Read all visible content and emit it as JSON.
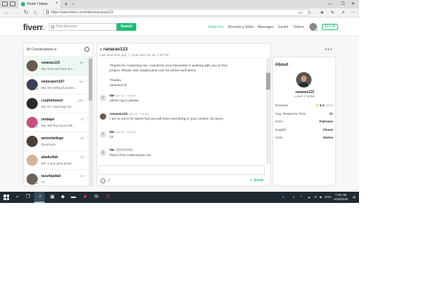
{
  "browser": {
    "tab_title": "Fiverr / Inbox",
    "url": "https://www.fiverr.com/inbox/ranarao123",
    "tab_close": "×",
    "new_tab": "+",
    "tab_menu": "⌄"
  },
  "header": {
    "logo": "fiverr",
    "logo_dot": ".",
    "search_placeholder": "Find Services",
    "search_button": "Search",
    "nav": [
      "Fiverr Pro",
      "Become a Seller",
      "Messages",
      "Saved",
      "Orders"
    ],
    "balance": "$14.00"
  },
  "conversations": {
    "filter_label": "All Conversations",
    "items": [
      {
        "name": "ranarao123",
        "preview": "Me: then we have to c...",
        "time": "9m",
        "active": true,
        "online": false,
        "avatar_color": "#6b5a4c"
      },
      {
        "name": "webexpert107",
        "preview": "Me: the selling function...",
        "time": "5m",
        "active": false,
        "online": true,
        "avatar_color": "#3a3f55"
      },
      {
        "name": "cryptomason",
        "preview": "Me: hi I need logo for...",
        "time": "22m",
        "active": false,
        "online": false,
        "avatar_color": "#2b2b2b"
      },
      {
        "name": "stedape",
        "preview": "Me: still few hours left...",
        "time": "1h",
        "active": false,
        "online": true,
        "avatar_color": "#c45080"
      },
      {
        "name": "aminebelkapi",
        "preview": "Good luck",
        "time": "2d",
        "active": false,
        "online": false,
        "avatar_color": "#4a4038"
      },
      {
        "name": "alaakullab",
        "preview": "Me: u just gone great",
        "time": "2d",
        "active": false,
        "online": false,
        "avatar_color": "#d3b49a"
      },
      {
        "name": "taoufiqaltali",
        "preview": "??",
        "time": "2d",
        "active": false,
        "online": true,
        "avatar_color": "#6d6356"
      }
    ]
  },
  "chat": {
    "username": "ranarao123",
    "last_seen": "Last seen 93m ago",
    "local_time": "Local time Apr 16, 7:33 PM",
    "separator": "|",
    "first_message_lines": [
      "Thanks for contacting me. I would be very interested in working with you on this",
      "project. Please visit utoplacosns.com for all the stuff demo.",
      "",
      "Thanks,",
      "ranarao123"
    ],
    "messages": [
      {
        "sender": "Me",
        "time": "Apr 16, 7:14 AM",
        "text": "admin log in please",
        "avatar": "E",
        "blurred": false
      },
      {
        "sender": "ranarao123",
        "time": "Apr 16, 7:14 AM",
        "text": "I am so sorry for admin but you will have everything in your control. No worry",
        "avatar": "photo",
        "blurred": false
      },
      {
        "sender": "Me",
        "time": "Apr 16, 7:16 AM",
        "text": "lol",
        "avatar": "E",
        "blurred": false
      },
      {
        "sender": "Me",
        "time": "",
        "text": "that is from codecanyon.net",
        "avatar": "E",
        "blurred": true
      }
    ],
    "send_label": "Send"
  },
  "about": {
    "title": "About",
    "name": "ranarao123",
    "level": "Level 1 Seller",
    "stats": [
      {
        "label": "Reviews",
        "value": "5.0",
        "extra": "(202)",
        "star": true
      },
      {
        "label": "Avg. Response Time",
        "value": "1h",
        "extra": "",
        "star": false
      },
      {
        "label": "From",
        "value": "Pakistan",
        "extra": "",
        "star": false
      },
      {
        "label": "English",
        "value": "Fluent",
        "extra": "",
        "star": false
      },
      {
        "label": "Urdu",
        "value": "Native",
        "extra": "",
        "star": false
      }
    ]
  },
  "help_label": "?",
  "taskbar": {
    "time": "7:33 AM",
    "date": "4/16/2019",
    "lang": "ENG"
  },
  "colors": {
    "brand": "#1dbf73",
    "taskbar": "#1f2a33"
  }
}
